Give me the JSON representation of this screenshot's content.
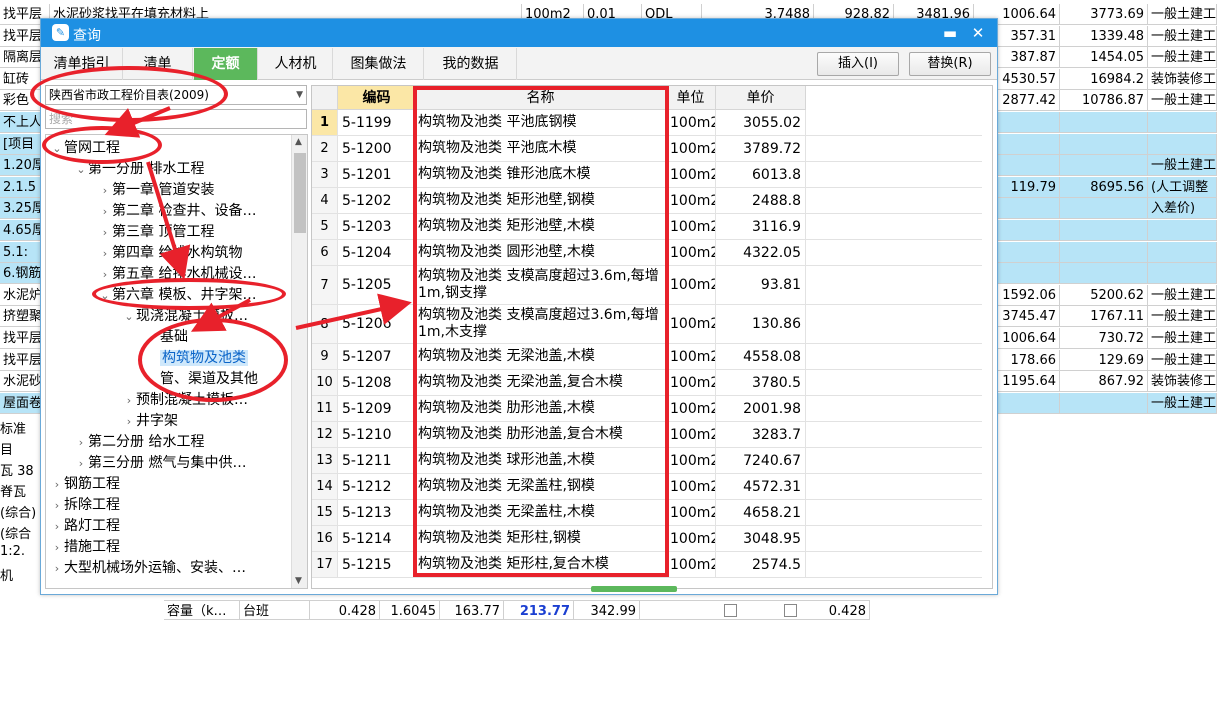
{
  "background_sheet": {
    "rows": [
      {
        "a": "找平层",
        "b": "水泥砂浆找平在填充材料上",
        "u": "100m2",
        "q": "0.01",
        "t": "QDL",
        "p1": "3.7488",
        "p2": "928.82",
        "p3": "3481.96",
        "v1": "1006.64",
        "v2": "3773.69",
        "c": "一般土建工",
        "hl": false
      },
      {
        "a": "找平层",
        "b": "",
        "u": "",
        "q": "",
        "t": "",
        "p1": "",
        "p2": "",
        "p3": "",
        "v1": "357.31",
        "v2": "1339.48",
        "c": "一般土建工",
        "hl": false
      },
      {
        "a": "隔离层",
        "b": "",
        "u": "",
        "q": "",
        "t": "",
        "p1": "",
        "p2": "",
        "p3": "",
        "v1": "387.87",
        "v2": "1454.05",
        "c": "一般土建工",
        "hl": false
      },
      {
        "a": "缸砖",
        "b": "",
        "u": "",
        "q": "",
        "t": "",
        "p1": "",
        "p2": "",
        "p3": "",
        "v1": "4530.57",
        "v2": "16984.2",
        "c": "装饰装修工",
        "hl": false
      },
      {
        "a": "彩色",
        "b": "",
        "u": "",
        "q": "",
        "t": "",
        "p1": "",
        "p2": "",
        "p3": "",
        "v1": "2877.42",
        "v2": "10786.87",
        "c": "一般土建工",
        "hl": false
      },
      {
        "a": "不上人",
        "b": "",
        "u": "",
        "q": "",
        "t": "",
        "p1": "",
        "p2": "",
        "p3": "",
        "v1": "",
        "v2": "",
        "c": "",
        "hl": true
      },
      {
        "a": "[项目",
        "b": "",
        "u": "",
        "q": "",
        "t": "",
        "p1": "",
        "p2": "",
        "p3": "",
        "v1": "",
        "v2": "",
        "c": "",
        "hl": true
      },
      {
        "a": "1.20厚",
        "b": "",
        "u": "",
        "q": "",
        "t": "",
        "p1": "",
        "p2": "",
        "p3": "",
        "v1": "",
        "v2": "",
        "c": "一般土建工",
        "hl": true
      },
      {
        "a": "2.1.5",
        "b": "",
        "u": "",
        "q": "",
        "t": "",
        "p1": "",
        "p2": "",
        "p3": "",
        "v1": "119.79",
        "v2": "8695.56",
        "c": "(人工调整",
        "hl": true
      },
      {
        "a": "3.25厚",
        "b": "",
        "u": "",
        "q": "",
        "t": "",
        "p1": "",
        "p2": "",
        "p3": "",
        "v1": "",
        "v2": "",
        "c": "入差价)",
        "hl": true
      },
      {
        "a": "4.65厚",
        "b": "",
        "u": "",
        "q": "",
        "t": "",
        "p1": "",
        "p2": "",
        "p3": "",
        "v1": "",
        "v2": "",
        "c": "",
        "hl": true
      },
      {
        "a": "5.1:",
        "b": "",
        "u": "",
        "q": "",
        "t": "",
        "p1": "",
        "p2": "",
        "p3": "",
        "v1": "",
        "v2": "",
        "c": "",
        "hl": true
      },
      {
        "a": "6.钢筋",
        "b": "",
        "u": "",
        "q": "",
        "t": "",
        "p1": "",
        "p2": "",
        "p3": "",
        "v1": "",
        "v2": "",
        "c": "",
        "hl": true
      },
      {
        "a": "水泥炉",
        "b": "",
        "u": "",
        "q": "",
        "t": "",
        "p1": "",
        "p2": "",
        "p3": "",
        "v1": "1592.06",
        "v2": "5200.62",
        "c": "一般土建工",
        "hl": false
      },
      {
        "a": "挤塑聚",
        "b": "",
        "u": "",
        "q": "",
        "t": "",
        "p1": "",
        "p2": "",
        "p3": "",
        "v1": "3745.47",
        "v2": "1767.11",
        "c": "一般土建工",
        "hl": false
      },
      {
        "a": "找平层",
        "b": "",
        "u": "",
        "q": "",
        "t": "",
        "p1": "",
        "p2": "",
        "p3": "",
        "v1": "1006.64",
        "v2": "730.72",
        "c": "一般土建工",
        "hl": false
      },
      {
        "a": "找平层",
        "b": "",
        "u": "",
        "q": "",
        "t": "",
        "p1": "",
        "p2": "",
        "p3": "",
        "v1": "178.66",
        "v2": "129.69",
        "c": "一般土建工",
        "hl": false
      },
      {
        "a": "水泥砂",
        "b": "",
        "u": "",
        "q": "",
        "t": "",
        "p1": "",
        "p2": "",
        "p3": "",
        "v1": "1195.64",
        "v2": "867.92",
        "c": "装饰装修工",
        "hl": false
      },
      {
        "a": "屋面卷",
        "b": "",
        "u": "",
        "q": "",
        "t": "",
        "p1": "",
        "p2": "",
        "p3": "",
        "v1": "",
        "v2": "",
        "c": "一般土建工",
        "hl": true
      }
    ],
    "lower_left": [
      "标准",
      "目",
      "瓦 38",
      "脊瓦",
      "(综合)",
      "(综合",
      "1:2.",
      "机"
    ],
    "bottom_row": {
      "name": "容量（k…",
      "unit": "台班",
      "v1": "0.428",
      "v2": "1.6045",
      "v3": "163.77",
      "v4": "213.77",
      "v5": "342.99",
      "v6": "0.428"
    }
  },
  "dialog": {
    "title": "查询",
    "tabs": [
      {
        "label": "清单指引",
        "active": false
      },
      {
        "label": "清单",
        "active": false
      },
      {
        "label": "定额",
        "active": true
      },
      {
        "label": "人材机",
        "active": false
      },
      {
        "label": "图集做法",
        "active": false
      },
      {
        "label": "我的数据",
        "active": false
      }
    ],
    "insert_button": "插入(I)",
    "replace_button": "替换(R)",
    "library_select": "陕西省市政工程价目表(2009)",
    "search_placeholder": "搜索",
    "tree": [
      {
        "label": "管网工程",
        "level": 0,
        "chev": "⌄"
      },
      {
        "label": "第一分册 排水工程",
        "level": 1,
        "chev": "⌄"
      },
      {
        "label": "第一章 管道安装",
        "level": 2,
        "chev": "›"
      },
      {
        "label": "第二章 检查井、设备…",
        "level": 2,
        "chev": "›"
      },
      {
        "label": "第三章 顶管工程",
        "level": 2,
        "chev": "›"
      },
      {
        "label": "第四章 给排水构筑物",
        "level": 2,
        "chev": "›"
      },
      {
        "label": "第五章 给排水机械设…",
        "level": 2,
        "chev": "›"
      },
      {
        "label": "第六章 模板、井字架…",
        "level": 2,
        "chev": "⌄"
      },
      {
        "label": "现浇混凝土模板…",
        "level": 3,
        "chev": "⌄"
      },
      {
        "label": "基础",
        "level": 4,
        "chev": ""
      },
      {
        "label": "构筑物及池类",
        "level": 4,
        "chev": "",
        "selected": true
      },
      {
        "label": "管、渠道及其他",
        "level": 4,
        "chev": ""
      },
      {
        "label": "预制混凝土模板…",
        "level": 3,
        "chev": "›"
      },
      {
        "label": "井字架",
        "level": 3,
        "chev": "›"
      },
      {
        "label": "第二分册 给水工程",
        "level": 1,
        "chev": "›"
      },
      {
        "label": "第三分册 燃气与集中供…",
        "level": 1,
        "chev": "›"
      },
      {
        "label": "钢筋工程",
        "level": 0,
        "chev": "›"
      },
      {
        "label": "拆除工程",
        "level": 0,
        "chev": "›"
      },
      {
        "label": "路灯工程",
        "level": 0,
        "chev": "›"
      },
      {
        "label": "措施工程",
        "level": 0,
        "chev": "›"
      },
      {
        "label": "大型机械场外运输、安装、…",
        "level": 0,
        "chev": "›"
      }
    ],
    "grid_headers": {
      "code": "编码",
      "name": "名称",
      "unit": "单位",
      "price": "单价"
    },
    "grid_rows": [
      {
        "n": "1",
        "code": "5-1199",
        "name": "构筑物及池类 平池底钢模",
        "unit": "100m2",
        "price": "3055.02"
      },
      {
        "n": "2",
        "code": "5-1200",
        "name": "构筑物及池类 平池底木模",
        "unit": "100m2",
        "price": "3789.72"
      },
      {
        "n": "3",
        "code": "5-1201",
        "name": "构筑物及池类 锥形池底木模",
        "unit": "100m2",
        "price": "6013.8"
      },
      {
        "n": "4",
        "code": "5-1202",
        "name": "构筑物及池类 矩形池壁,钢模",
        "unit": "100m2",
        "price": "2488.8"
      },
      {
        "n": "5",
        "code": "5-1203",
        "name": "构筑物及池类 矩形池壁,木模",
        "unit": "100m2",
        "price": "3116.9"
      },
      {
        "n": "6",
        "code": "5-1204",
        "name": "构筑物及池类 圆形池壁,木模",
        "unit": "100m2",
        "price": "4322.05"
      },
      {
        "n": "7",
        "code": "5-1205",
        "name": "构筑物及池类 支模高度超过3.6m,每增1m,钢支撑",
        "unit": "100m2",
        "price": "93.81"
      },
      {
        "n": "8",
        "code": "5-1206",
        "name": "构筑物及池类 支模高度超过3.6m,每增1m,木支撑",
        "unit": "100m2",
        "price": "130.86"
      },
      {
        "n": "9",
        "code": "5-1207",
        "name": "构筑物及池类 无梁池盖,木模",
        "unit": "100m2",
        "price": "4558.08"
      },
      {
        "n": "10",
        "code": "5-1208",
        "name": "构筑物及池类 无梁池盖,复合木模",
        "unit": "100m2",
        "price": "3780.5"
      },
      {
        "n": "11",
        "code": "5-1209",
        "name": "构筑物及池类 肋形池盖,木模",
        "unit": "100m2",
        "price": "2001.98"
      },
      {
        "n": "12",
        "code": "5-1210",
        "name": "构筑物及池类 肋形池盖,复合木模",
        "unit": "100m2",
        "price": "3283.7"
      },
      {
        "n": "13",
        "code": "5-1211",
        "name": "构筑物及池类 球形池盖,木模",
        "unit": "100m2",
        "price": "7240.67"
      },
      {
        "n": "14",
        "code": "5-1212",
        "name": "构筑物及池类 无梁盖柱,钢模",
        "unit": "100m2",
        "price": "4572.31"
      },
      {
        "n": "15",
        "code": "5-1213",
        "name": "构筑物及池类 无梁盖柱,木模",
        "unit": "100m2",
        "price": "4658.21"
      },
      {
        "n": "16",
        "code": "5-1214",
        "name": "构筑物及池类 矩形柱,钢模",
        "unit": "100m2",
        "price": "3048.95"
      },
      {
        "n": "17",
        "code": "5-1215",
        "name": "构筑物及池类 矩形柱,复合木模",
        "unit": "100m2",
        "price": "2574.5"
      }
    ]
  },
  "annotation_color": "#e8212b"
}
